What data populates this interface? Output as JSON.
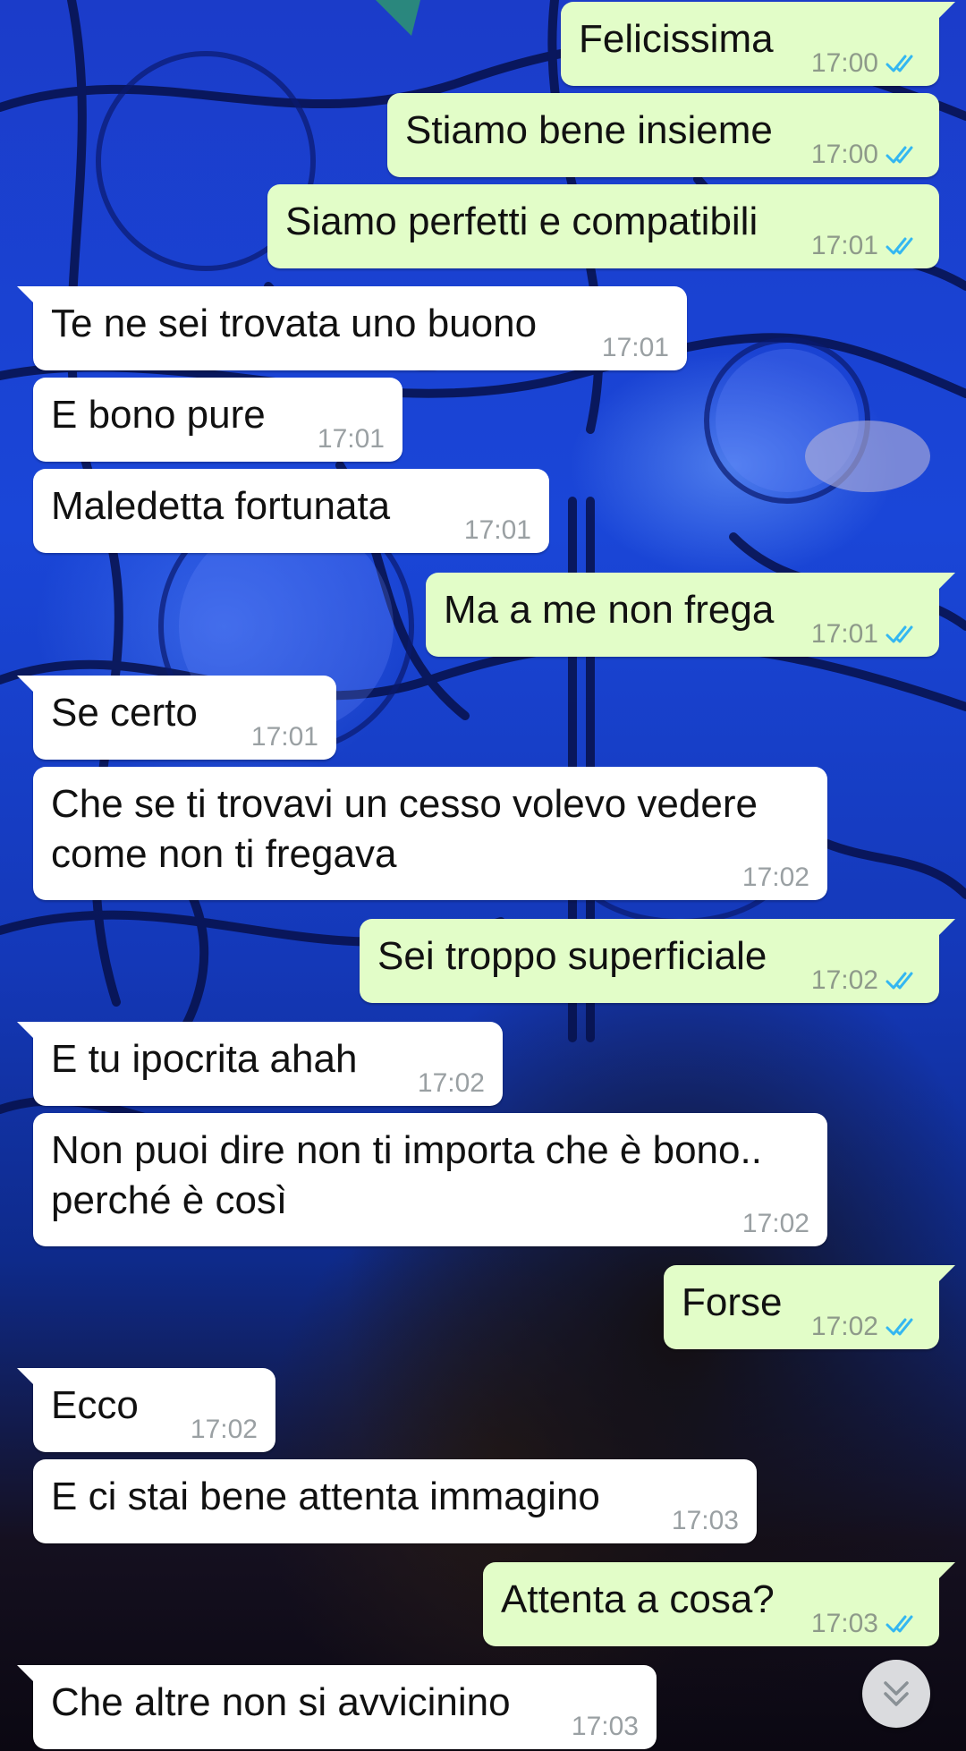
{
  "colors": {
    "incoming_bubble": "#ffffff",
    "outgoing_bubble": "#e2fdc8",
    "read_ticks": "#34b7f1",
    "timestamp": "#9aa0a3"
  },
  "messages": [
    {
      "dir": "out",
      "text": "Felicissima",
      "time": "17:00",
      "status": "read"
    },
    {
      "dir": "out",
      "text": "Stiamo bene insieme",
      "time": "17:00",
      "status": "read"
    },
    {
      "dir": "out",
      "text": "Siamo perfetti e compatibili",
      "time": "17:01",
      "status": "read"
    },
    {
      "dir": "in",
      "text": "Te ne sei trovata uno buono",
      "time": "17:01"
    },
    {
      "dir": "in",
      "text": "E bono pure",
      "time": "17:01"
    },
    {
      "dir": "in",
      "text": "Maledetta fortunata",
      "time": "17:01"
    },
    {
      "dir": "out",
      "text": "Ma a me non frega",
      "time": "17:01",
      "status": "read"
    },
    {
      "dir": "in",
      "text": "Se certo",
      "time": "17:01"
    },
    {
      "dir": "in",
      "text": "Che se ti trovavi un cesso volevo vedere\ncome non ti fregava",
      "time": "17:02"
    },
    {
      "dir": "out",
      "text": "Sei troppo superficiale",
      "time": "17:02",
      "status": "read"
    },
    {
      "dir": "in",
      "text": "E tu ipocrita ahah",
      "time": "17:02"
    },
    {
      "dir": "in",
      "text": "Non puoi dire non ti importa che è bono..\nperché è così",
      "time": "17:02"
    },
    {
      "dir": "out",
      "text": "Forse",
      "time": "17:02",
      "status": "read"
    },
    {
      "dir": "in",
      "text": "Ecco",
      "time": "17:02"
    },
    {
      "dir": "in",
      "text": "E ci stai bene attenta immagino",
      "time": "17:03"
    },
    {
      "dir": "out",
      "text": "Attenta a cosa?",
      "time": "17:03",
      "status": "read"
    },
    {
      "dir": "in",
      "text": "Che altre non si avvicinino",
      "time": "17:03"
    }
  ],
  "scroll_button": {
    "icon": "double-chevron-down-icon"
  }
}
